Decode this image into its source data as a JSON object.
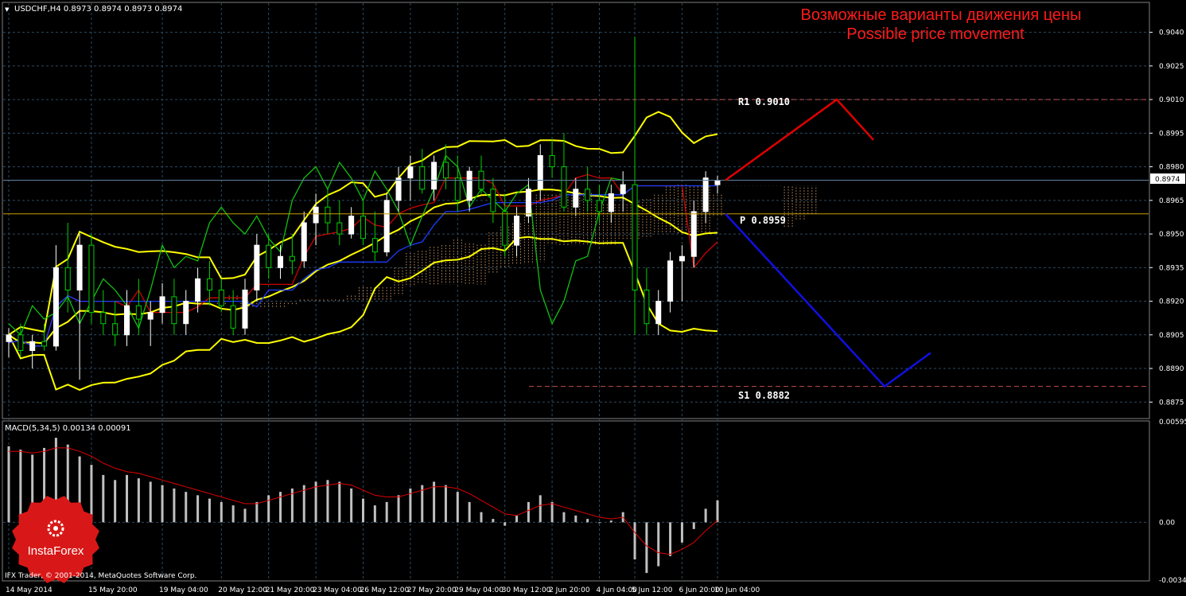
{
  "header": {
    "dropdown_glyph": "▼",
    "symbol_info": "USDCHF,H4  0.8973 0.8974 0.8973 0.8974",
    "macd_info": "MACD(5,34,5) 0.00134 0.00091"
  },
  "annotation": {
    "title_ru": "Возможные варианты движения цены",
    "title_en": "Possible price movement"
  },
  "levels": {
    "r1_label": "R1 0.9010",
    "p_label": "P 0.8959",
    "s1_label": "S1 0.8882",
    "current_price_label": "0.8974"
  },
  "price_axis": [
    "0.9040",
    "0.9025",
    "0.9010",
    "0.8995",
    "0.8980",
    "0.8965",
    "0.8950",
    "0.8935",
    "0.8920",
    "0.8905",
    "0.8890",
    "0.8875"
  ],
  "macd_axis": [
    "0.00595",
    "0.00",
    "-0.00342"
  ],
  "time_axis": [
    "14 May 2014",
    "15 May 20:00",
    "19 May 04:00",
    "20 May 12:00",
    "21 May 20:00",
    "23 May 04:00",
    "26 May 12:00",
    "27 May 20:00",
    "29 May 04:00",
    "30 May 12:00",
    "2 Jun 20:00",
    "4 Jun 04:00",
    "5 Jun 12:00",
    "6 Jun 20:00",
    "10 Jun 04:00"
  ],
  "logo": {
    "brand": "InstaForex",
    "icon": "gear-bull-icon"
  },
  "copyright": "IFX Trader, © 2001-2014, MetaQuotes Software Corp.",
  "colors": {
    "background": "#000000",
    "grid": "#2b4a62",
    "bull": "#ffffff",
    "bear": "#00d000",
    "bollinger": "#ffff00",
    "tenkan": "#d00000",
    "kijun": "#1c3cff",
    "chikou": "#10c010",
    "cloud": "#c49060",
    "level_line": "#c0504d",
    "pivot_line": "#c8a000",
    "bull_path": "#e00000",
    "bear_path": "#1010e0",
    "macd_hist": "#c0c0c0",
    "macd_signal": "#e00000"
  },
  "chart_data": [
    {
      "type": "candlestick",
      "title": "USDCHF,H4",
      "ylim": [
        0.8868,
        0.9053
      ],
      "candles": [
        {
          "t": "14 May 2014",
          "o": 0.8902,
          "h": 0.8908,
          "l": 0.8895,
          "c": 0.8905
        },
        {
          "t": "",
          "o": 0.8905,
          "h": 0.891,
          "l": 0.8895,
          "c": 0.8898
        },
        {
          "t": "",
          "o": 0.8898,
          "h": 0.8905,
          "l": 0.889,
          "c": 0.8902
        },
        {
          "t": "",
          "o": 0.8902,
          "h": 0.891,
          "l": 0.8898,
          "c": 0.89
        },
        {
          "t": "",
          "o": 0.89,
          "h": 0.8945,
          "l": 0.8898,
          "c": 0.8935
        },
        {
          "t": "",
          "o": 0.8935,
          "h": 0.8955,
          "l": 0.8915,
          "c": 0.8925
        },
        {
          "t": "",
          "o": 0.8925,
          "h": 0.895,
          "l": 0.8885,
          "c": 0.8945
        },
        {
          "t": "15 May 20:00",
          "o": 0.8945,
          "h": 0.895,
          "l": 0.891,
          "c": 0.8915
        },
        {
          "t": "",
          "o": 0.8915,
          "h": 0.8925,
          "l": 0.8905,
          "c": 0.891
        },
        {
          "t": "",
          "o": 0.891,
          "h": 0.892,
          "l": 0.89,
          "c": 0.8905
        },
        {
          "t": "",
          "o": 0.8905,
          "h": 0.8925,
          "l": 0.89,
          "c": 0.8918
        },
        {
          "t": "",
          "o": 0.8918,
          "h": 0.893,
          "l": 0.8905,
          "c": 0.8912
        },
        {
          "t": "",
          "o": 0.8912,
          "h": 0.892,
          "l": 0.89,
          "c": 0.8915
        },
        {
          "t": "19 May 04:00",
          "o": 0.8915,
          "h": 0.8928,
          "l": 0.891,
          "c": 0.8922
        },
        {
          "t": "",
          "o": 0.8922,
          "h": 0.893,
          "l": 0.8905,
          "c": 0.891
        },
        {
          "t": "",
          "o": 0.891,
          "h": 0.8925,
          "l": 0.8905,
          "c": 0.892
        },
        {
          "t": "",
          "o": 0.892,
          "h": 0.8935,
          "l": 0.8915,
          "c": 0.893
        },
        {
          "t": "",
          "o": 0.893,
          "h": 0.8938,
          "l": 0.8918,
          "c": 0.8925
        },
        {
          "t": "20 May 12:00",
          "o": 0.8925,
          "h": 0.893,
          "l": 0.8915,
          "c": 0.8918
        },
        {
          "t": "",
          "o": 0.8918,
          "h": 0.8925,
          "l": 0.8905,
          "c": 0.8908
        },
        {
          "t": "",
          "o": 0.8908,
          "h": 0.893,
          "l": 0.8905,
          "c": 0.8925
        },
        {
          "t": "",
          "o": 0.8925,
          "h": 0.895,
          "l": 0.892,
          "c": 0.8945
        },
        {
          "t": "21 May 20:00",
          "o": 0.8945,
          "h": 0.895,
          "l": 0.893,
          "c": 0.8935
        },
        {
          "t": "",
          "o": 0.8935,
          "h": 0.8945,
          "l": 0.893,
          "c": 0.894
        },
        {
          "t": "",
          "o": 0.894,
          "h": 0.895,
          "l": 0.8932,
          "c": 0.8938
        },
        {
          "t": "",
          "o": 0.8938,
          "h": 0.896,
          "l": 0.8935,
          "c": 0.8955
        },
        {
          "t": "23 May 04:00",
          "o": 0.8955,
          "h": 0.8968,
          "l": 0.8945,
          "c": 0.8962
        },
        {
          "t": "",
          "o": 0.8962,
          "h": 0.897,
          "l": 0.895,
          "c": 0.8955
        },
        {
          "t": "",
          "o": 0.8955,
          "h": 0.8965,
          "l": 0.8945,
          "c": 0.895
        },
        {
          "t": "",
          "o": 0.895,
          "h": 0.8962,
          "l": 0.8948,
          "c": 0.8958
        },
        {
          "t": "26 May 12:00",
          "o": 0.8958,
          "h": 0.8965,
          "l": 0.8945,
          "c": 0.8948
        },
        {
          "t": "",
          "o": 0.8948,
          "h": 0.896,
          "l": 0.8938,
          "c": 0.8942
        },
        {
          "t": "",
          "o": 0.8942,
          "h": 0.8968,
          "l": 0.894,
          "c": 0.8965
        },
        {
          "t": "",
          "o": 0.8965,
          "h": 0.898,
          "l": 0.896,
          "c": 0.8975
        },
        {
          "t": "27 May 20:00",
          "o": 0.8975,
          "h": 0.8985,
          "l": 0.8965,
          "c": 0.898
        },
        {
          "t": "",
          "o": 0.898,
          "h": 0.8988,
          "l": 0.8968,
          "c": 0.897
        },
        {
          "t": "",
          "o": 0.897,
          "h": 0.8985,
          "l": 0.8965,
          "c": 0.8982
        },
        {
          "t": "",
          "o": 0.8982,
          "h": 0.899,
          "l": 0.897,
          "c": 0.8975
        },
        {
          "t": "29 May 04:00",
          "o": 0.8975,
          "h": 0.8985,
          "l": 0.896,
          "c": 0.8965
        },
        {
          "t": "",
          "o": 0.8965,
          "h": 0.898,
          "l": 0.896,
          "c": 0.8978
        },
        {
          "t": "",
          "o": 0.8978,
          "h": 0.8985,
          "l": 0.8968,
          "c": 0.897
        },
        {
          "t": "",
          "o": 0.897,
          "h": 0.8975,
          "l": 0.8955,
          "c": 0.896
        },
        {
          "t": "30 May 12:00",
          "o": 0.896,
          "h": 0.8968,
          "l": 0.894,
          "c": 0.8945
        },
        {
          "t": "",
          "o": 0.8945,
          "h": 0.8962,
          "l": 0.894,
          "c": 0.8958
        },
        {
          "t": "",
          "o": 0.8958,
          "h": 0.8975,
          "l": 0.8955,
          "c": 0.897
        },
        {
          "t": "",
          "o": 0.897,
          "h": 0.899,
          "l": 0.8965,
          "c": 0.8985
        },
        {
          "t": "2 Jun 20:00",
          "o": 0.8985,
          "h": 0.8992,
          "l": 0.8975,
          "c": 0.898
        },
        {
          "t": "",
          "o": 0.898,
          "h": 0.8995,
          "l": 0.896,
          "c": 0.8962
        },
        {
          "t": "",
          "o": 0.8962,
          "h": 0.8975,
          "l": 0.8958,
          "c": 0.897
        },
        {
          "t": "",
          "o": 0.897,
          "h": 0.898,
          "l": 0.896,
          "c": 0.8965
        },
        {
          "t": "4 Jun 04:00",
          "o": 0.8965,
          "h": 0.8972,
          "l": 0.8955,
          "c": 0.896
        },
        {
          "t": "",
          "o": 0.896,
          "h": 0.8972,
          "l": 0.8955,
          "c": 0.8968
        },
        {
          "t": "",
          "o": 0.8968,
          "h": 0.8978,
          "l": 0.896,
          "c": 0.8972
        },
        {
          "t": "5 Jun 12:00",
          "o": 0.8972,
          "h": 0.9038,
          "l": 0.8905,
          "c": 0.8925
        },
        {
          "t": "",
          "o": 0.8925,
          "h": 0.8935,
          "l": 0.8905,
          "c": 0.891
        },
        {
          "t": "",
          "o": 0.891,
          "h": 0.8925,
          "l": 0.8905,
          "c": 0.892
        },
        {
          "t": "",
          "o": 0.892,
          "h": 0.8942,
          "l": 0.8915,
          "c": 0.8938
        },
        {
          "t": "6 Jun 20:00",
          "o": 0.8938,
          "h": 0.8945,
          "l": 0.892,
          "c": 0.894
        },
        {
          "t": "",
          "o": 0.894,
          "h": 0.8965,
          "l": 0.8935,
          "c": 0.896
        },
        {
          "t": "",
          "o": 0.896,
          "h": 0.8978,
          "l": 0.8955,
          "c": 0.8975
        },
        {
          "t": "10 Jun 04:00",
          "o": 0.8972,
          "h": 0.8976,
          "l": 0.8968,
          "c": 0.8974
        }
      ],
      "levels": [
        {
          "name": "R1",
          "value": 0.901
        },
        {
          "name": "P",
          "value": 0.8959
        },
        {
          "name": "S1",
          "value": 0.8882
        }
      ],
      "current_price": 0.8974,
      "bullish_path": [
        0.8974,
        0.901,
        0.8992
      ],
      "bearish_path": [
        0.8959,
        0.8882,
        0.8897
      ]
    },
    {
      "type": "bar",
      "title": "MACD(5,34,5)",
      "ylim": [
        -0.00342,
        0.00595
      ],
      "values": [
        0.0045,
        0.0043,
        0.004,
        0.0044,
        0.005,
        0.0046,
        0.0039,
        0.0034,
        0.0028,
        0.0025,
        0.0028,
        0.0026,
        0.0024,
        0.0022,
        0.002,
        0.0018,
        0.0016,
        0.0014,
        0.0012,
        0.001,
        0.0008,
        0.0012,
        0.0016,
        0.0018,
        0.002,
        0.0022,
        0.0024,
        0.0025,
        0.0024,
        0.002,
        0.0014,
        0.001,
        0.0012,
        0.0016,
        0.002,
        0.0022,
        0.0024,
        0.0022,
        0.0018,
        0.0012,
        0.0006,
        0.0002,
        -0.0002,
        0.0004,
        0.0012,
        0.0016,
        0.0012,
        0.0006,
        0.0004,
        0.0002,
        0.0,
        0.0001,
        0.0006,
        -0.0022,
        -0.003,
        -0.0026,
        -0.002,
        -0.0012,
        -0.0004,
        0.0008,
        0.0013
      ],
      "signal": [
        0.0042,
        0.0042,
        0.0041,
        0.0042,
        0.0044,
        0.0044,
        0.0042,
        0.0039,
        0.0035,
        0.0032,
        0.003,
        0.0029,
        0.0027,
        0.0025,
        0.0023,
        0.0021,
        0.0019,
        0.0017,
        0.0015,
        0.0013,
        0.0011,
        0.0011,
        0.0013,
        0.0015,
        0.0017,
        0.0019,
        0.0021,
        0.0022,
        0.0023,
        0.0022,
        0.0019,
        0.0016,
        0.0015,
        0.0015,
        0.0017,
        0.0019,
        0.0021,
        0.0021,
        0.002,
        0.0017,
        0.0013,
        0.0009,
        0.0005,
        0.0004,
        0.0007,
        0.001,
        0.0011,
        0.0009,
        0.0007,
        0.0005,
        0.0003,
        0.0002,
        0.0003,
        -0.0006,
        -0.0014,
        -0.0018,
        -0.0019,
        -0.0016,
        -0.0012,
        -0.0005,
        0.0001
      ]
    }
  ]
}
